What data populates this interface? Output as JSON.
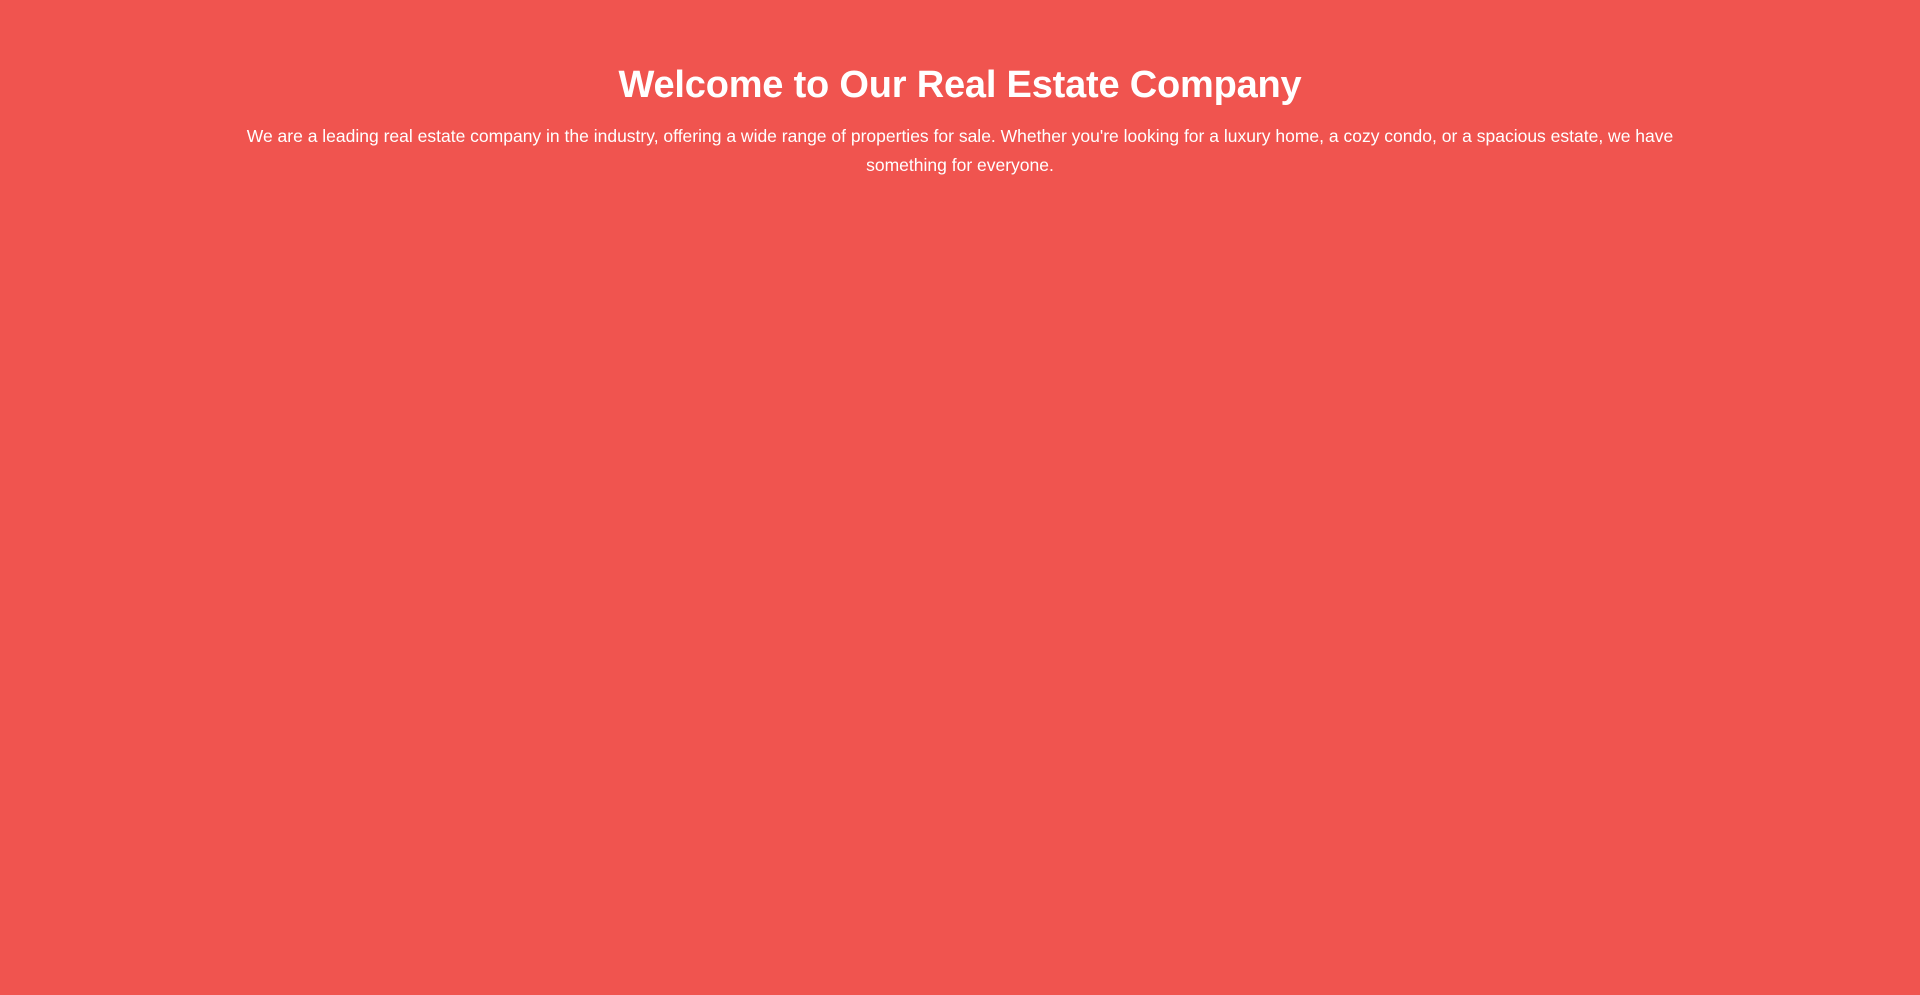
{
  "theme": {
    "background": "#f0544f",
    "text_color": "#ffffff"
  },
  "hero": {
    "title": "Welcome to Our Real Estate Company",
    "description": "We are a leading real estate company in the industry, offering a wide range of properties for sale. Whether you're looking for a luxury home, a cozy condo, or a spacious estate, we have something for everyone."
  }
}
